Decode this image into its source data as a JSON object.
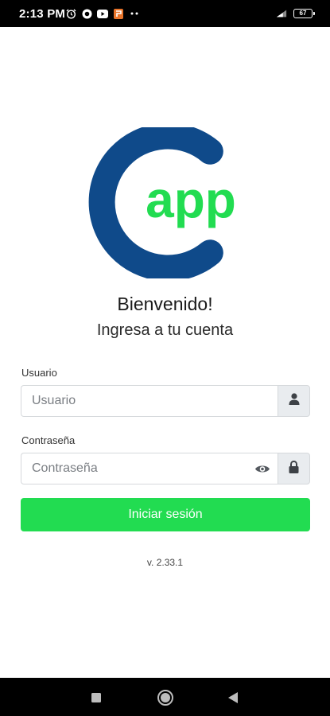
{
  "status_bar": {
    "time": "2:13 PM",
    "battery": "67",
    "icons_left": [
      "alarm-icon",
      "app-circle-icon",
      "youtube-icon",
      "app-orange-icon",
      "more-dots-icon"
    ],
    "icons_right": [
      "signal-icon",
      "battery-icon"
    ]
  },
  "logo": {
    "text": "app",
    "ring_color": "#0f4a8a",
    "text_color": "#22dc51"
  },
  "header": {
    "title": "Bienvenido!",
    "subtitle": "Ingresa a tu cuenta"
  },
  "form": {
    "username": {
      "label": "Usuario",
      "placeholder": "Usuario",
      "value": "",
      "addon_icon": "user-icon"
    },
    "password": {
      "label": "Contraseña",
      "placeholder": "Contraseña",
      "value": "",
      "toggle_icon": "eye-icon",
      "addon_icon": "lock-icon"
    },
    "submit_label": "Iniciar sesión"
  },
  "footer": {
    "version": "v. 2.33.1"
  },
  "nav_bar": {
    "buttons": [
      "recents-square-icon",
      "home-circle-icon",
      "back-triangle-icon"
    ]
  },
  "colors": {
    "accent": "#22dc51",
    "brand_blue": "#0f4a8a",
    "addon_bg": "#e9ecef"
  }
}
